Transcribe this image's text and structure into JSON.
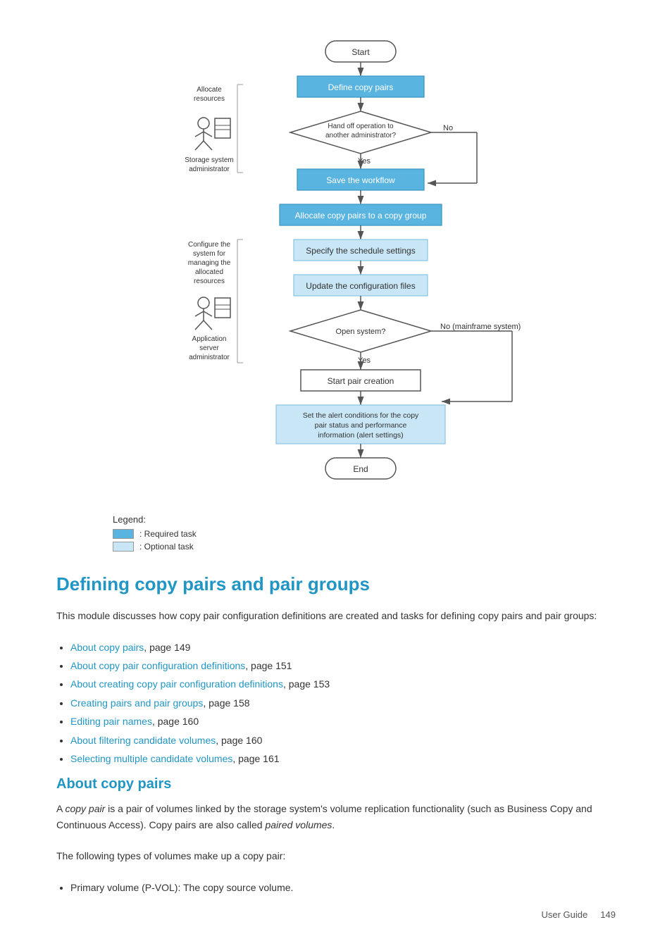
{
  "flowchart": {
    "nodes": {
      "start": "Start",
      "define_copy_pairs": "Define copy pairs",
      "hand_off": "Hand off operation to\nanother administrator?",
      "no_label": "No",
      "yes_label": "Yes",
      "save_workflow": "Save the workflow",
      "allocate_copy_pairs": "Allocate copy pairs to a copy group",
      "specify_schedule": "Specify the schedule settings",
      "update_config": "Update the configuration files",
      "open_system": "Open system?",
      "no_mainframe": "No (mainframe system)",
      "yes2": "Yes",
      "start_pair": "Start pair creation",
      "set_alert": "Set the alert conditions for the copy\npair status and performance\ninformation (alert settings)",
      "end": "End"
    },
    "side_labels": {
      "storage_admin": "Allocate\nresources\n\nStorage system\nadministrator",
      "app_admin": "Configure the\nsystem for\nmanaging the\nallocated\nresources\n\nApplication\nserver\nadministrator"
    }
  },
  "legend": {
    "title": "Legend:",
    "required": ": Required task",
    "optional": ": Optional task"
  },
  "main_section": {
    "heading": "Defining copy pairs and pair groups",
    "intro": "This module discusses how copy pair configuration definitions are created and tasks for defining copy pairs and pair groups:",
    "links": [
      {
        "text": "About copy pairs",
        "suffix": ", page 149"
      },
      {
        "text": "About copy pair configuration definitions",
        "suffix": ", page 151"
      },
      {
        "text": "About creating copy pair configuration definitions",
        "suffix": ", page 153"
      },
      {
        "text": "Creating pairs and pair groups",
        "suffix": ", page 158"
      },
      {
        "text": "Editing pair names",
        "suffix": ", page 160"
      },
      {
        "text": "About filtering candidate volumes",
        "suffix": ", page 160"
      },
      {
        "text": "Selecting multiple candidate volumes",
        "suffix": ", page 161"
      }
    ]
  },
  "about_section": {
    "heading": "About copy pairs",
    "para1_pre": "A ",
    "para1_italic": "copy pair",
    "para1_mid": " is a pair of volumes linked by the storage system's volume replication functionality (such as Business Copy and Continuous Access). Copy pairs are also called ",
    "para1_italic2": "paired volumes",
    "para1_end": ".",
    "para2": "The following types of volumes make up a copy pair:",
    "bullets": [
      "Primary volume (P-VOL): The copy source volume."
    ]
  },
  "footer": {
    "label": "User Guide",
    "page": "149"
  }
}
